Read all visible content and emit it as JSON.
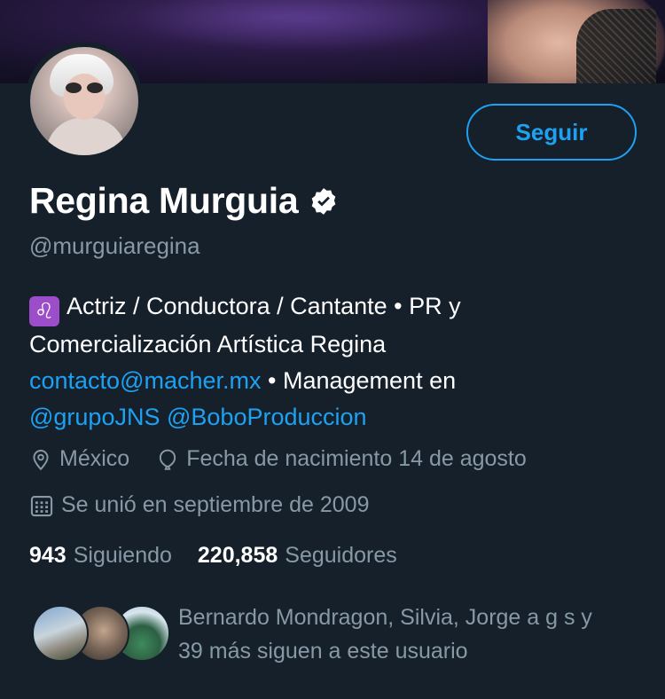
{
  "profile": {
    "name": "Regina Murguia",
    "handle": "@murguiaregina",
    "follow_label": "Seguir",
    "verified": true
  },
  "bio": {
    "emoji": "♌",
    "line1": "Actriz / Conductora / Cantante • PR y",
    "line2": "Comercialización Artística Regina",
    "email": "contacto@macher.mx",
    "mgmt_text": " • Management en",
    "mention1": "@grupoJNS",
    "mention2": "@BoboProduccion"
  },
  "meta": {
    "location": "México",
    "birthday": "Fecha de nacimiento 14 de agosto",
    "joined": "Se unió en septiembre de 2009"
  },
  "counts": {
    "following_num": "943",
    "following_label": "Siguiendo",
    "followers_num": "220,858",
    "followers_label": "Seguidores"
  },
  "followed_by": {
    "line1": "Bernardo Mondragon, Silvia, Jorge a g s y",
    "line2": "39 más siguen a este usuario"
  },
  "colors": {
    "background": "#15202b",
    "accent": "#1da1f2",
    "secondary_text": "#8899a6"
  }
}
